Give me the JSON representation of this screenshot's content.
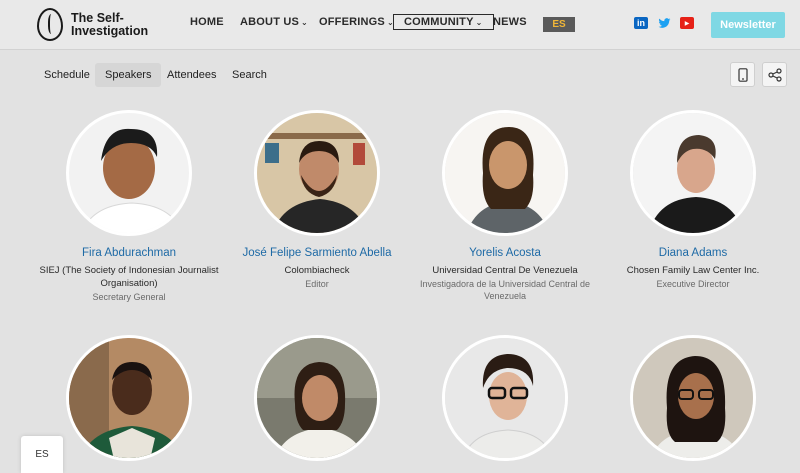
{
  "brand": {
    "name_line1": "The Self-",
    "name_line2": "Investigation"
  },
  "nav": {
    "home": "HOME",
    "about": "ABOUT US",
    "offerings": "OFFERINGS",
    "community": "COMMUNITY",
    "news": "NEWS",
    "lang": "ES",
    "newsletter": "Newsletter"
  },
  "social": {
    "linkedin": {
      "glyph": "in",
      "color": "#0a66c2",
      "icon": "linkedin-icon"
    },
    "twitter": {
      "glyph": "t",
      "color": "#1da1f2",
      "icon": "twitter-icon"
    },
    "youtube": {
      "glyph": "▶",
      "color": "#e62117",
      "icon": "youtube-icon"
    }
  },
  "tabs": [
    {
      "label": "Schedule",
      "active": false
    },
    {
      "label": "Speakers",
      "active": true
    },
    {
      "label": "Attendees",
      "active": false
    },
    {
      "label": "Search",
      "active": false
    }
  ],
  "speakers": [
    {
      "name": "Fira Abdurachman",
      "org": "SIEJ (The Society of Indonesian Journalist Organisation)",
      "title": "Secretary General"
    },
    {
      "name": "José Felipe Sarmiento Abella",
      "org": "Colombiacheck",
      "title": "Editor"
    },
    {
      "name": "Yorelis Acosta",
      "org": "Universidad Central De Venezuela",
      "title": "Investigadora de la Universidad Central de Venezuela"
    },
    {
      "name": "Diana Adams",
      "org": "Chosen Family Law Center Inc.",
      "title": "Executive Director"
    }
  ],
  "language_switcher": "ES",
  "colors": {
    "accent": "#7fd8e4",
    "link": "#1e6aa6",
    "lang_badge_text": "#f0b638"
  }
}
